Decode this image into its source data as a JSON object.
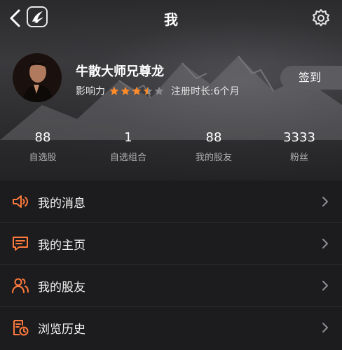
{
  "header": {
    "title": "我"
  },
  "profile": {
    "name": "牛散大师兄尊龙",
    "influence_label": "影响力",
    "rating": 3.5,
    "rating_max": 5,
    "register_text": "注册时长:6个月",
    "signin_label": "签到"
  },
  "stats": [
    {
      "value": "88",
      "label": "自选股"
    },
    {
      "value": "1",
      "label": "自选组合"
    },
    {
      "value": "88",
      "label": "我的股友"
    },
    {
      "value": "3333",
      "label": "粉丝"
    }
  ],
  "menu": [
    {
      "label": "我的消息",
      "icon": "speaker-icon"
    },
    {
      "label": "我的主页",
      "icon": "message-icon"
    },
    {
      "label": "我的股友",
      "icon": "users-icon"
    },
    {
      "label": "浏览历史",
      "icon": "history-icon"
    }
  ],
  "colors": {
    "accent": "#ff7a3d",
    "star_on": "#ff8a2a",
    "star_off": "#8a8a8c"
  }
}
